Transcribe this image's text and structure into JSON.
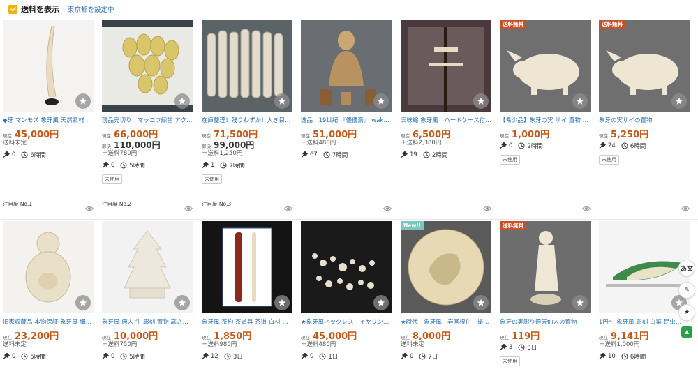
{
  "topbar": {
    "show_shipping": "送料を表示",
    "location_link": "東京都を設定中"
  },
  "labels": {
    "current": "現在",
    "buynow": "即決",
    "bid": "現在"
  },
  "rows": [
    {
      "items": [
        {
          "title": "◆牙 マンモス 象牙風 天然素材 …",
          "price_label": "現在",
          "price": "45,000円",
          "buynow": "",
          "shipping": "送料未定",
          "bids": "0",
          "time": "6時間",
          "tag": "",
          "rank": "注目度 No.1",
          "badge": "",
          "img": "tusk"
        },
        {
          "title": "現品売切り！マッコウ鯨歯 アク…",
          "price_label": "現在",
          "price": "66,000円",
          "buynow_label": "即決",
          "buynow": "110,000円",
          "shipping": "＋送料780円",
          "bids": "0",
          "time": "5時間",
          "tag": "未使用",
          "rank": "注目度 No.2",
          "badge": "",
          "img": "teeth"
        },
        {
          "title": "在庫整理！残りわずか！大き目…",
          "price_label": "現在",
          "price": "71,500円",
          "buynow_label": "即決",
          "buynow": "99,000円",
          "shipping": "＋送料1,250円",
          "bids": "1",
          "time": "7時間",
          "tag": "未使用",
          "rank": "注目度 No.3",
          "badge": "",
          "img": "slabs"
        },
        {
          "title": "逸品　19世紀 『優優斎』 wak…",
          "price_label": "現在",
          "price": "51,000円",
          "buynow": "",
          "shipping": "＋送料480円",
          "bids": "67",
          "time": "7時間",
          "tag": "",
          "rank": "",
          "badge": "",
          "img": "figure"
        },
        {
          "title": "三味線 象牙風　ハードケース付…",
          "price_label": "現在",
          "price": "6,500円",
          "buynow": "",
          "shipping": "＋送料2,380円",
          "bids": "19",
          "time": "2時間",
          "tag": "",
          "rank": "",
          "badge": "",
          "img": "shamisen"
        },
        {
          "title": "【希少品】象牙の実 サイ 置物 …",
          "price_label": "現在",
          "price": "1,000円",
          "buynow": "",
          "shipping": "",
          "bids": "0",
          "time": "2時間",
          "tag": "未使用",
          "rank": "",
          "badge": "送料無料",
          "img": "rhino"
        },
        {
          "title": "象牙の実サイの置物",
          "price_label": "現在",
          "price": "5,250円",
          "buynow": "",
          "shipping": "",
          "bids": "24",
          "time": "6時間",
          "tag": "未使用",
          "rank": "",
          "badge": "送料無料",
          "img": "rhino"
        }
      ]
    },
    {
      "items": [
        {
          "title": "旧家収蔵品 本物保証 象牙風 細…",
          "price_label": "現在",
          "price": "23,200円",
          "buynow": "",
          "shipping": "送料未定",
          "bids": "0",
          "time": "5時間",
          "tag": "",
          "rank": "",
          "badge": "",
          "img": "buddha"
        },
        {
          "title": "象牙風 唐人 牛 彫刻 置物 高さ…",
          "price_label": "現在",
          "price": "10,000円",
          "buynow": "",
          "shipping": "＋送料750円",
          "bids": "0",
          "time": "5時間",
          "tag": "",
          "rank": "",
          "badge": "",
          "img": "tower"
        },
        {
          "title": "象牙風 茶杓 茶道具 茶道 白材 …",
          "price_label": "現在",
          "price": "1,850円",
          "buynow": "",
          "shipping": "＋送料980円",
          "bids": "12",
          "time": "3日",
          "tag": "",
          "rank": "",
          "badge": "",
          "img": "chashaku"
        },
        {
          "title": "★象牙風ネックレス　イヤリン…",
          "price_label": "現在",
          "price": "45,000円",
          "buynow": "",
          "shipping": "＋送料480円",
          "bids": "0",
          "time": "1日",
          "tag": "",
          "rank": "",
          "badge": "",
          "img": "beads"
        },
        {
          "title": "★時代　象牙風　春画根付　撮…",
          "price_label": "現在",
          "price": "8,000円",
          "buynow": "",
          "shipping": "送料未定",
          "bids": "0",
          "time": "7日",
          "tag": "",
          "rank": "",
          "badge": "New!!",
          "img": "netsuke"
        },
        {
          "title": "象牙の実彫り飛天仙人の置物",
          "price_label": "現在",
          "price": "119円",
          "buynow": "",
          "shipping": "",
          "bids": "3",
          "time": "3日",
          "tag": "未使用",
          "rank": "",
          "badge": "送料無料",
          "img": "statue"
        },
        {
          "title": "1円〜 象牙風 彫刻 白菜 昆虫…",
          "price_label": "現在",
          "price": "9,141円",
          "buynow": "",
          "shipping": "＋送料1,000円",
          "bids": "10",
          "time": "6時間",
          "tag": "",
          "rank": "",
          "badge": "",
          "img": "cabbage"
        }
      ]
    }
  ],
  "side_buttons": [
    "あ文",
    "✎",
    "★"
  ],
  "colors": {
    "price": "#c45a1a",
    "link": "#2a6fb0",
    "free_badge": "#c4522a",
    "new_badge": "#7cc6c0"
  }
}
